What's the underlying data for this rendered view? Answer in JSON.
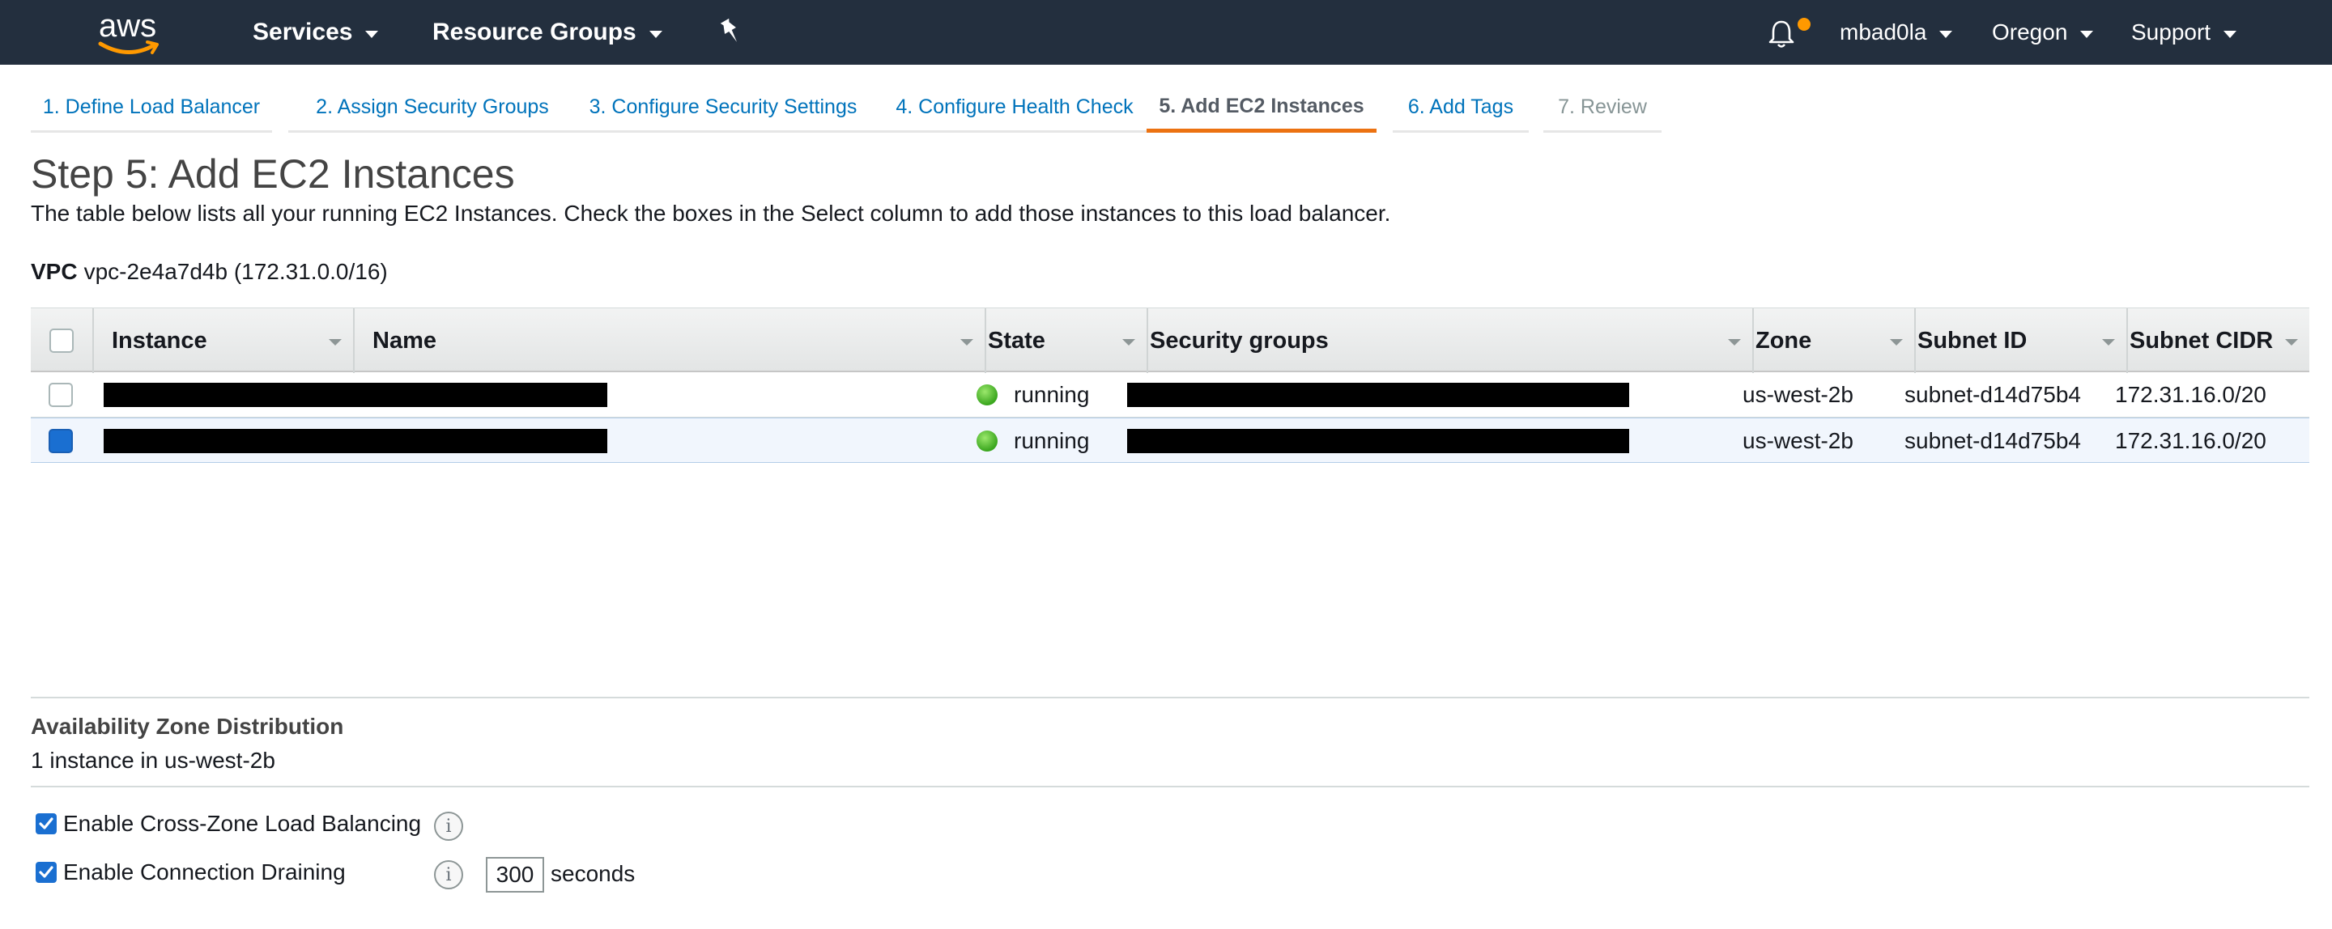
{
  "topnav": {
    "logo": "aws",
    "services": "Services",
    "resource_groups": "Resource Groups",
    "pin_icon": "pin-icon",
    "bell_icon": "bell-icon",
    "user": "mbad0la",
    "region": "Oregon",
    "support": "Support"
  },
  "wizard": {
    "tabs": [
      {
        "label": "1. Define Load Balancer",
        "state": "link"
      },
      {
        "label": "2. Assign Security Groups",
        "state": "link"
      },
      {
        "label": "3. Configure Security Settings",
        "state": "link"
      },
      {
        "label": "4. Configure Health Check",
        "state": "link"
      },
      {
        "label": "5. Add EC2 Instances",
        "state": "active"
      },
      {
        "label": "6. Add Tags",
        "state": "link"
      },
      {
        "label": "7. Review",
        "state": "disabled"
      }
    ]
  },
  "page": {
    "title": "Step 5: Add EC2 Instances",
    "description": "The table below lists all your running EC2 Instances. Check the boxes in the Select column to add those instances to this load balancer.",
    "vpc_label": "VPC",
    "vpc_value": "vpc-2e4a7d4b (172.31.0.0/16)"
  },
  "table": {
    "columns": [
      "Instance",
      "Name",
      "State",
      "Security groups",
      "Zone",
      "Subnet ID",
      "Subnet CIDR"
    ],
    "rows": [
      {
        "selected": false,
        "state": "running",
        "zone": "us-west-2b",
        "subnet_id": "subnet-d14d75b4",
        "subnet_cidr": "172.31.16.0/20"
      },
      {
        "selected": true,
        "state": "running",
        "zone": "us-west-2b",
        "subnet_id": "subnet-d14d75b4",
        "subnet_cidr": "172.31.16.0/20"
      }
    ]
  },
  "az_distribution": {
    "title": "Availability Zone Distribution",
    "value": "1 instance in us-west-2b"
  },
  "options": {
    "cross_zone_label": "Enable Cross-Zone Load Balancing",
    "cross_zone_checked": true,
    "draining_label": "Enable Connection Draining",
    "draining_checked": true,
    "draining_timeout": "300",
    "draining_unit": "seconds",
    "info_glyph": "i"
  },
  "colors": {
    "nav_bg": "#232f3e",
    "link": "#0073bb",
    "active_tab_underline": "#ec7211",
    "notification_dot": "#ff9900",
    "running_green": "#3aa61e"
  }
}
